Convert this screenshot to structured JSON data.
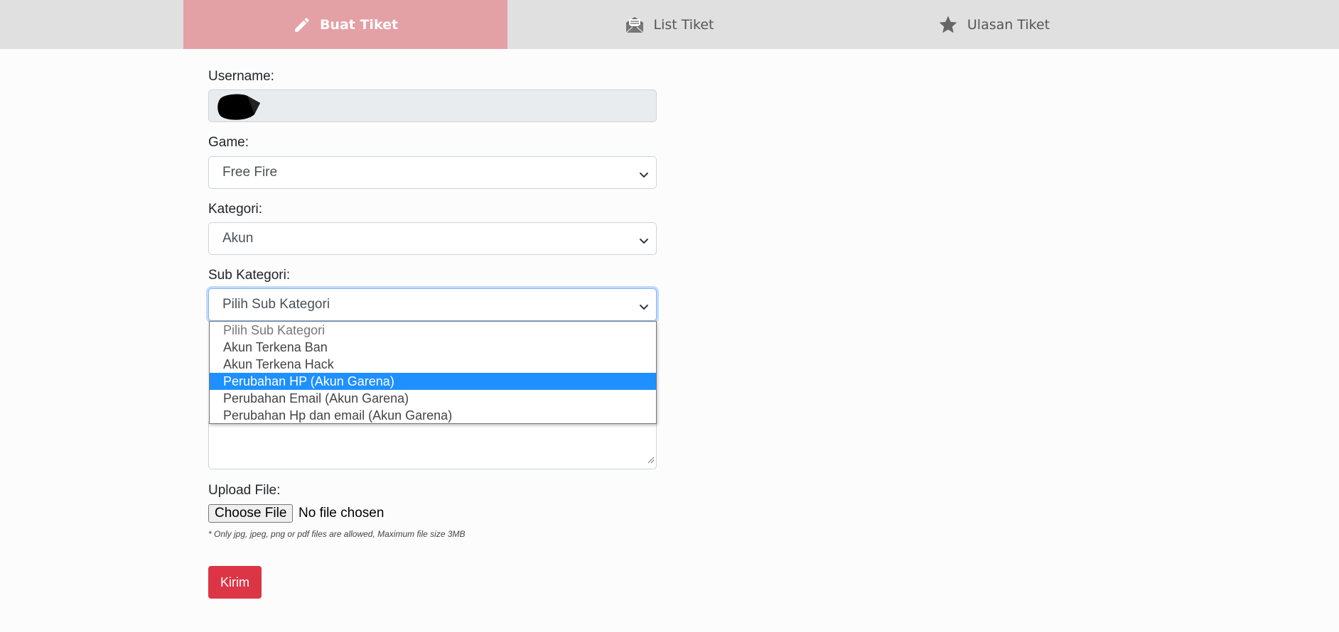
{
  "tabs": {
    "create": {
      "label": "Buat Tiket",
      "icon": "pencil-icon"
    },
    "list": {
      "label": "List Tiket",
      "icon": "envelope-open-icon"
    },
    "review": {
      "label": "Ulasan Tiket",
      "icon": "star-icon"
    }
  },
  "form": {
    "username_label": "Username:",
    "username_value": "",
    "game_label": "Game:",
    "game_value": "Free Fire",
    "kategori_label": "Kategori:",
    "kategori_value": "Akun",
    "subkategori_label": "Sub Kategori:",
    "subkategori_value": "Pilih Sub Kategori",
    "subkategori_options": [
      "Pilih Sub Kategori",
      "Akun Terkena Ban",
      "Akun Terkena Hack",
      "Perubahan HP (Akun Garena)",
      "Perubahan Email (Akun Garena)",
      "Perubahan Hp dan email (Akun Garena)"
    ],
    "subkategori_highlighted": "Perubahan HP (Akun Garena)",
    "upload_label": "Upload File:",
    "choose_file_label": "Choose File",
    "no_file_text": "No file chosen",
    "upload_note": "* Only jpg, jpeg, png or pdf files are allowed, Maximum file size 3MB",
    "submit_label": "Kirim"
  },
  "colors": {
    "active_tab": "#e3a0a5",
    "tabbar": "#e0e0e0",
    "highlight": "#1e90ff",
    "submit": "#dc3545"
  }
}
